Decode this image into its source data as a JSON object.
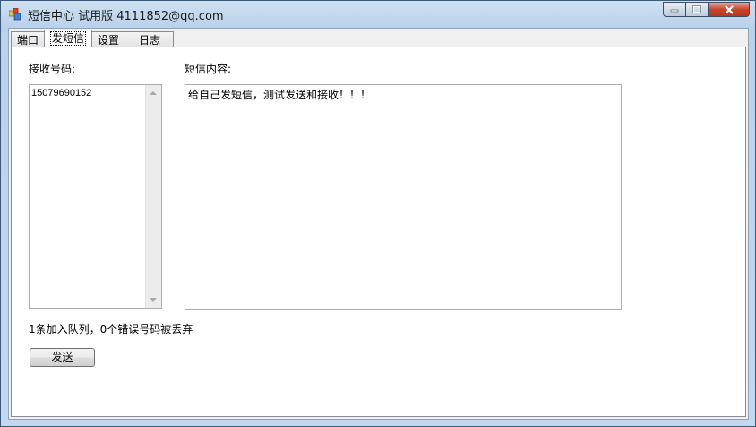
{
  "window": {
    "title": "短信中心 试用版 4111852@qq.com"
  },
  "tabs": [
    {
      "label": "端口"
    },
    {
      "label": "发短信"
    },
    {
      "label": "设置"
    },
    {
      "label": "日志"
    }
  ],
  "send_sms": {
    "recipients_label": "接收号码:",
    "recipients": [
      "15079690152"
    ],
    "content_label": "短信内容:",
    "content": "给自己发短信，测试发送和接收！！！",
    "status": "1条加入队列，0个错误号码被丢弃",
    "send_button": "发送"
  },
  "colors": {
    "close_button": "#c7442c",
    "tab_border": "#898c95"
  }
}
